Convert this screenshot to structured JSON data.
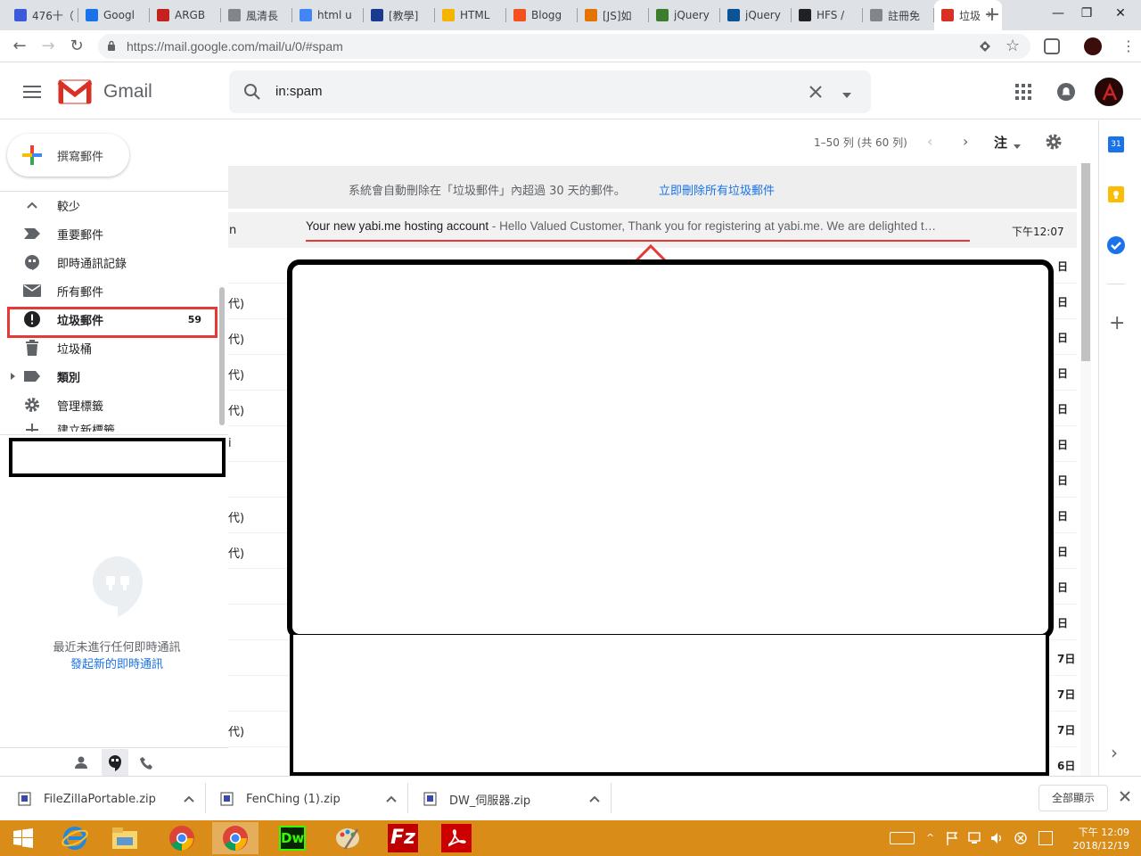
{
  "browser": {
    "tabs": [
      {
        "label": "476十（",
        "color": "#3b5bdb"
      },
      {
        "label": "Googl",
        "color": "#1a73e8"
      },
      {
        "label": "ARGB",
        "color": "#c5221f"
      },
      {
        "label": "風清長",
        "color": "#80868b"
      },
      {
        "label": "html u",
        "color": "#4285f4"
      },
      {
        "label": "[教學]",
        "color": "#1a3a8f"
      },
      {
        "label": "HTML",
        "color": "#f4b400"
      },
      {
        "label": "Blogg",
        "color": "#f4511e"
      },
      {
        "label": "[JS]如",
        "color": "#e37400"
      },
      {
        "label": "jQuery",
        "color": "#3c7d2e"
      },
      {
        "label": "jQuery",
        "color": "#0b5394"
      },
      {
        "label": "HFS /",
        "color": "#202124"
      },
      {
        "label": "註冊免",
        "color": "#80868b"
      },
      {
        "label": "垃圾",
        "color": "#d93025",
        "active": true
      }
    ],
    "new_tab": "+",
    "window_controls": [
      "—",
      "❐",
      "✕"
    ],
    "url": "https://mail.google.com/mail/u/0/#spam"
  },
  "gmail": {
    "logo_text": "Gmail",
    "search_value": "in:spam",
    "compose_label": "撰寫郵件",
    "nav": [
      {
        "label": "較少",
        "icon": "chevron-up-icon"
      },
      {
        "label": "重要郵件",
        "icon": "important-icon"
      },
      {
        "label": "即時通訊記錄",
        "icon": "chat-icon"
      },
      {
        "label": "所有郵件",
        "icon": "mail-icon"
      },
      {
        "label": "垃圾郵件",
        "icon": "spam-icon",
        "count": "59",
        "active": true
      },
      {
        "label": "垃圾桶",
        "icon": "trash-icon"
      },
      {
        "label": "類別",
        "icon": "label-icon",
        "bold": true
      },
      {
        "label": "管理標籤",
        "icon": "gear-icon"
      },
      {
        "label": "建立新標籤",
        "icon": "plus-icon"
      }
    ],
    "hangouts_empty": "最近未進行任何即時通訊",
    "hangouts_start": "發起新的即時通訊",
    "pagination": "1–50 列 (共 60 列)",
    "input_tool": "注",
    "spam_notice": "系統會自動刪除在「垃圾郵件」內超過 30 天的郵件。",
    "spam_delete_link": "立即刪除所有垃圾郵件",
    "first_mail": {
      "sender_partial": "n",
      "subject": "Your new yabi.me hosting account",
      "snippet": " - Hello Valued Customer, Thank you for registering at yabi.me. We are delighted t…",
      "time": "下午12:07"
    },
    "row_fragments": [
      {
        "left": "",
        "date": "日"
      },
      {
        "left": "代)",
        "date": "日"
      },
      {
        "left": "代)",
        "date": "日"
      },
      {
        "left": "代)",
        "date": "日"
      },
      {
        "left": "代)",
        "date": "日"
      },
      {
        "left": "i",
        "date": "日"
      },
      {
        "left": "",
        "date": "日"
      },
      {
        "left": "代)",
        "date": "日"
      },
      {
        "left": "代)",
        "date": "日"
      },
      {
        "left": "",
        "date": "日"
      },
      {
        "left": "",
        "date": "日"
      },
      {
        "left": "",
        "date": "7日"
      },
      {
        "left": "",
        "date": "7日"
      },
      {
        "left": "代)",
        "date": "7日"
      },
      {
        "left": "",
        "date": "6日"
      }
    ]
  },
  "downloads": {
    "items": [
      "FileZillaPortable.zip",
      "FenChing (1).zip",
      "DW_伺服器.zip"
    ],
    "show_all": "全部顯示"
  },
  "taskbar": {
    "time": "下午 12:09",
    "date": "2018/12/19"
  }
}
